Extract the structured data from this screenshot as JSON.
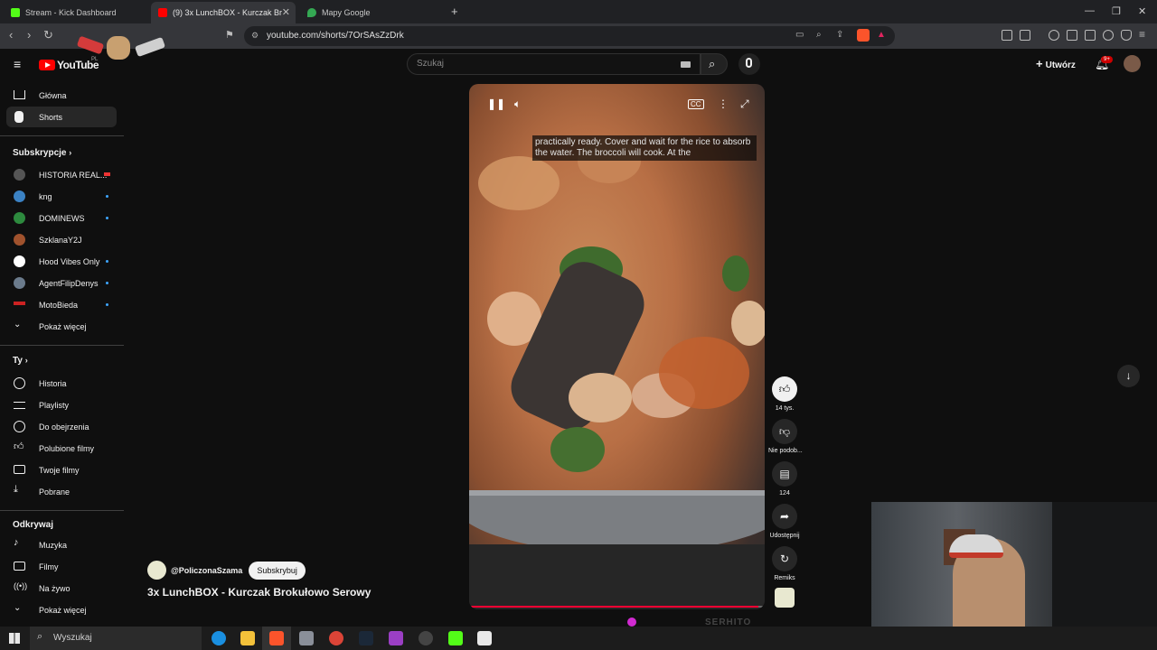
{
  "browser": {
    "tabs": [
      {
        "title": "Stream - Kick Dashboard",
        "active": false,
        "favicon_color": "#53fc18"
      },
      {
        "title": "(9) 3x LunchBOX - Kurczak Br",
        "active": true,
        "favicon_color": "#ff0000"
      },
      {
        "title": "Mapy Google",
        "active": false,
        "favicon_color": "#34a853"
      }
    ],
    "new_tab_glyph": "+",
    "url": "youtube.com/shorts/7OrSAsZzDrk"
  },
  "youtube": {
    "logo_text": "YouTube",
    "logo_region": "PL",
    "search_placeholder": "Szukaj",
    "create_label": "Utwórz",
    "notification_count": "9+"
  },
  "sidebar": {
    "main": [
      {
        "label": "Główna",
        "icon": "home-icon",
        "active": false
      },
      {
        "label": "Shorts",
        "icon": "shorts-icon",
        "active": true
      }
    ],
    "subs_heading": "Subskrypcje",
    "subscriptions": [
      {
        "label": "HISTORIA REAL...",
        "dot": "live",
        "color": "#555"
      },
      {
        "label": "kng",
        "dot": "new",
        "color": "#3b82c4"
      },
      {
        "label": "DOMINEWS",
        "dot": "new",
        "color": "#2d8a3e"
      },
      {
        "label": "SzklanaY2J",
        "dot": "",
        "color": "#a0522d"
      },
      {
        "label": "Hood Vibes Only",
        "dot": "new",
        "color": "#ffffff"
      },
      {
        "label": "AgentFilipDenys",
        "dot": "new",
        "color": "#6b7b8c"
      },
      {
        "label": "MotoBieda",
        "dot": "new",
        "color": "#cc2222"
      }
    ],
    "show_more_1": "Pokaż więcej",
    "you_heading": "Ty",
    "you_items": [
      {
        "label": "Historia",
        "icon": "history-icon"
      },
      {
        "label": "Playlisty",
        "icon": "playlist-icon"
      },
      {
        "label": "Do obejrzenia",
        "icon": "watch-later-icon"
      },
      {
        "label": "Polubione filmy",
        "icon": "liked-icon"
      },
      {
        "label": "Twoje filmy",
        "icon": "your-videos-icon"
      },
      {
        "label": "Pobrane",
        "icon": "download-icon"
      }
    ],
    "explore_heading": "Odkrywaj",
    "explore_items": [
      {
        "label": "Muzyka",
        "icon": "music-icon"
      },
      {
        "label": "Filmy",
        "icon": "movies-icon"
      },
      {
        "label": "Na żywo",
        "icon": "live-icon"
      }
    ],
    "show_more_2": "Pokaż więcej"
  },
  "short": {
    "caption": "practically ready. Cover and wait for the rice to absorb the water. The broccoli will cook. At the",
    "channel": "@PoliczonaSzama",
    "subscribe_label": "Subskrybuj",
    "title": "3x LunchBOX - Kurczak Brokułowo Serowy",
    "progress": 0.98,
    "actions": {
      "like": "14 tys.",
      "dislike": "Nie podob...",
      "comments": "124",
      "share": "Udostępnij",
      "remix": "Remiks"
    }
  },
  "taskbar": {
    "search_label": "Wyszukaj"
  }
}
